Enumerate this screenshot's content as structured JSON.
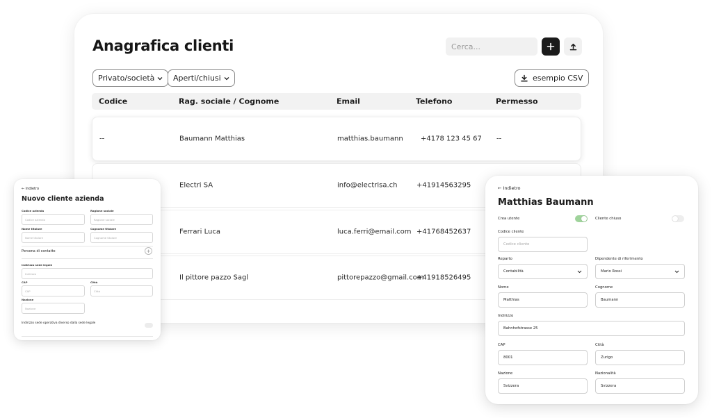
{
  "main": {
    "title": "Anagrafica clienti",
    "search_placeholder": "Cerca...",
    "filters": [
      {
        "label": "Privato/società"
      },
      {
        "label": "Aperti/chiusi"
      }
    ],
    "csv_button": "esempio CSV",
    "columns": [
      "Codice",
      "Rag. sociale / Cognome",
      "Email",
      "Telefono",
      "Permesso"
    ],
    "rows": [
      {
        "codice": "--",
        "nome": "Baumann Matthias",
        "email": "matthias.baumann",
        "telefono": "+4178 123 45 67",
        "permesso": "--"
      },
      {
        "codice": "",
        "nome": "Electri SA",
        "email": "info@electrisa.ch",
        "telefono": "+41914563295",
        "permesso": ""
      },
      {
        "codice": "",
        "nome": "Ferrari Luca",
        "email": "luca.ferri@email.com",
        "telefono": "+41768452637",
        "permesso": ""
      },
      {
        "codice": "",
        "nome": "Il pittore pazzo Sagl",
        "email": "pittorepazzo@gmail.com",
        "telefono": "+41918526495",
        "permesso": ""
      }
    ]
  },
  "left_panel": {
    "back": "← Indietro",
    "title": "Nuovo cliente azienda",
    "fields": {
      "codice_azienda": {
        "label": "Codice azienda",
        "placeholder": "Codice azienda"
      },
      "ragione_sociale": {
        "label": "Ragione sociale",
        "placeholder": "Ragione sociale"
      },
      "nome_titolare": {
        "label": "Nome titolare",
        "placeholder": "Nome titolare"
      },
      "cognome_titolare": {
        "label": "Cognome titolare",
        "placeholder": "Cognome titolare"
      },
      "indirizzo": {
        "label": "Indirizzo sede legale",
        "placeholder": "Indirizzo"
      },
      "cap": {
        "label": "CAP",
        "placeholder": "CAP"
      },
      "citta": {
        "label": "Città",
        "placeholder": "Città"
      },
      "nazione": {
        "label": "Nazione",
        "placeholder": "Nazione"
      }
    },
    "contact_section": "Persona di contatto",
    "sede_operativa": "Indirizzo sede operativa diverso dalla sede legale"
  },
  "right_panel": {
    "back": "← Indietro",
    "title": "Matthias Baumann",
    "crea_utente": {
      "label": "Crea utente",
      "on": true
    },
    "cliente_chiuso": {
      "label": "Cliente chiuso",
      "on": false
    },
    "codice_cliente": {
      "label": "Codice cliente",
      "placeholder": "Codice cliente"
    },
    "reparto": {
      "label": "Reparto",
      "value": "Contabilità"
    },
    "dipendente": {
      "label": "Dipendente di riferimento",
      "value": "Mario Rossi"
    },
    "nome": {
      "label": "Nome",
      "value": "Matthias"
    },
    "cognome": {
      "label": "Cognome",
      "value": "Baumann"
    },
    "indirizzo": {
      "label": "Indirizzo",
      "value": "Bahnhofstrasse 25"
    },
    "cap": {
      "label": "CAP",
      "value": "8001"
    },
    "citta": {
      "label": "Città",
      "value": "Zurigo"
    },
    "nazione": {
      "label": "Nazione",
      "value": "Svizzera"
    },
    "nazionalita": {
      "label": "Nazionalità",
      "value": "Svizzera"
    }
  },
  "colors": {
    "primary_dark": "#1b1b1b",
    "toggle_on": "#9fd39b",
    "header_bg": "#f2f2f2"
  }
}
